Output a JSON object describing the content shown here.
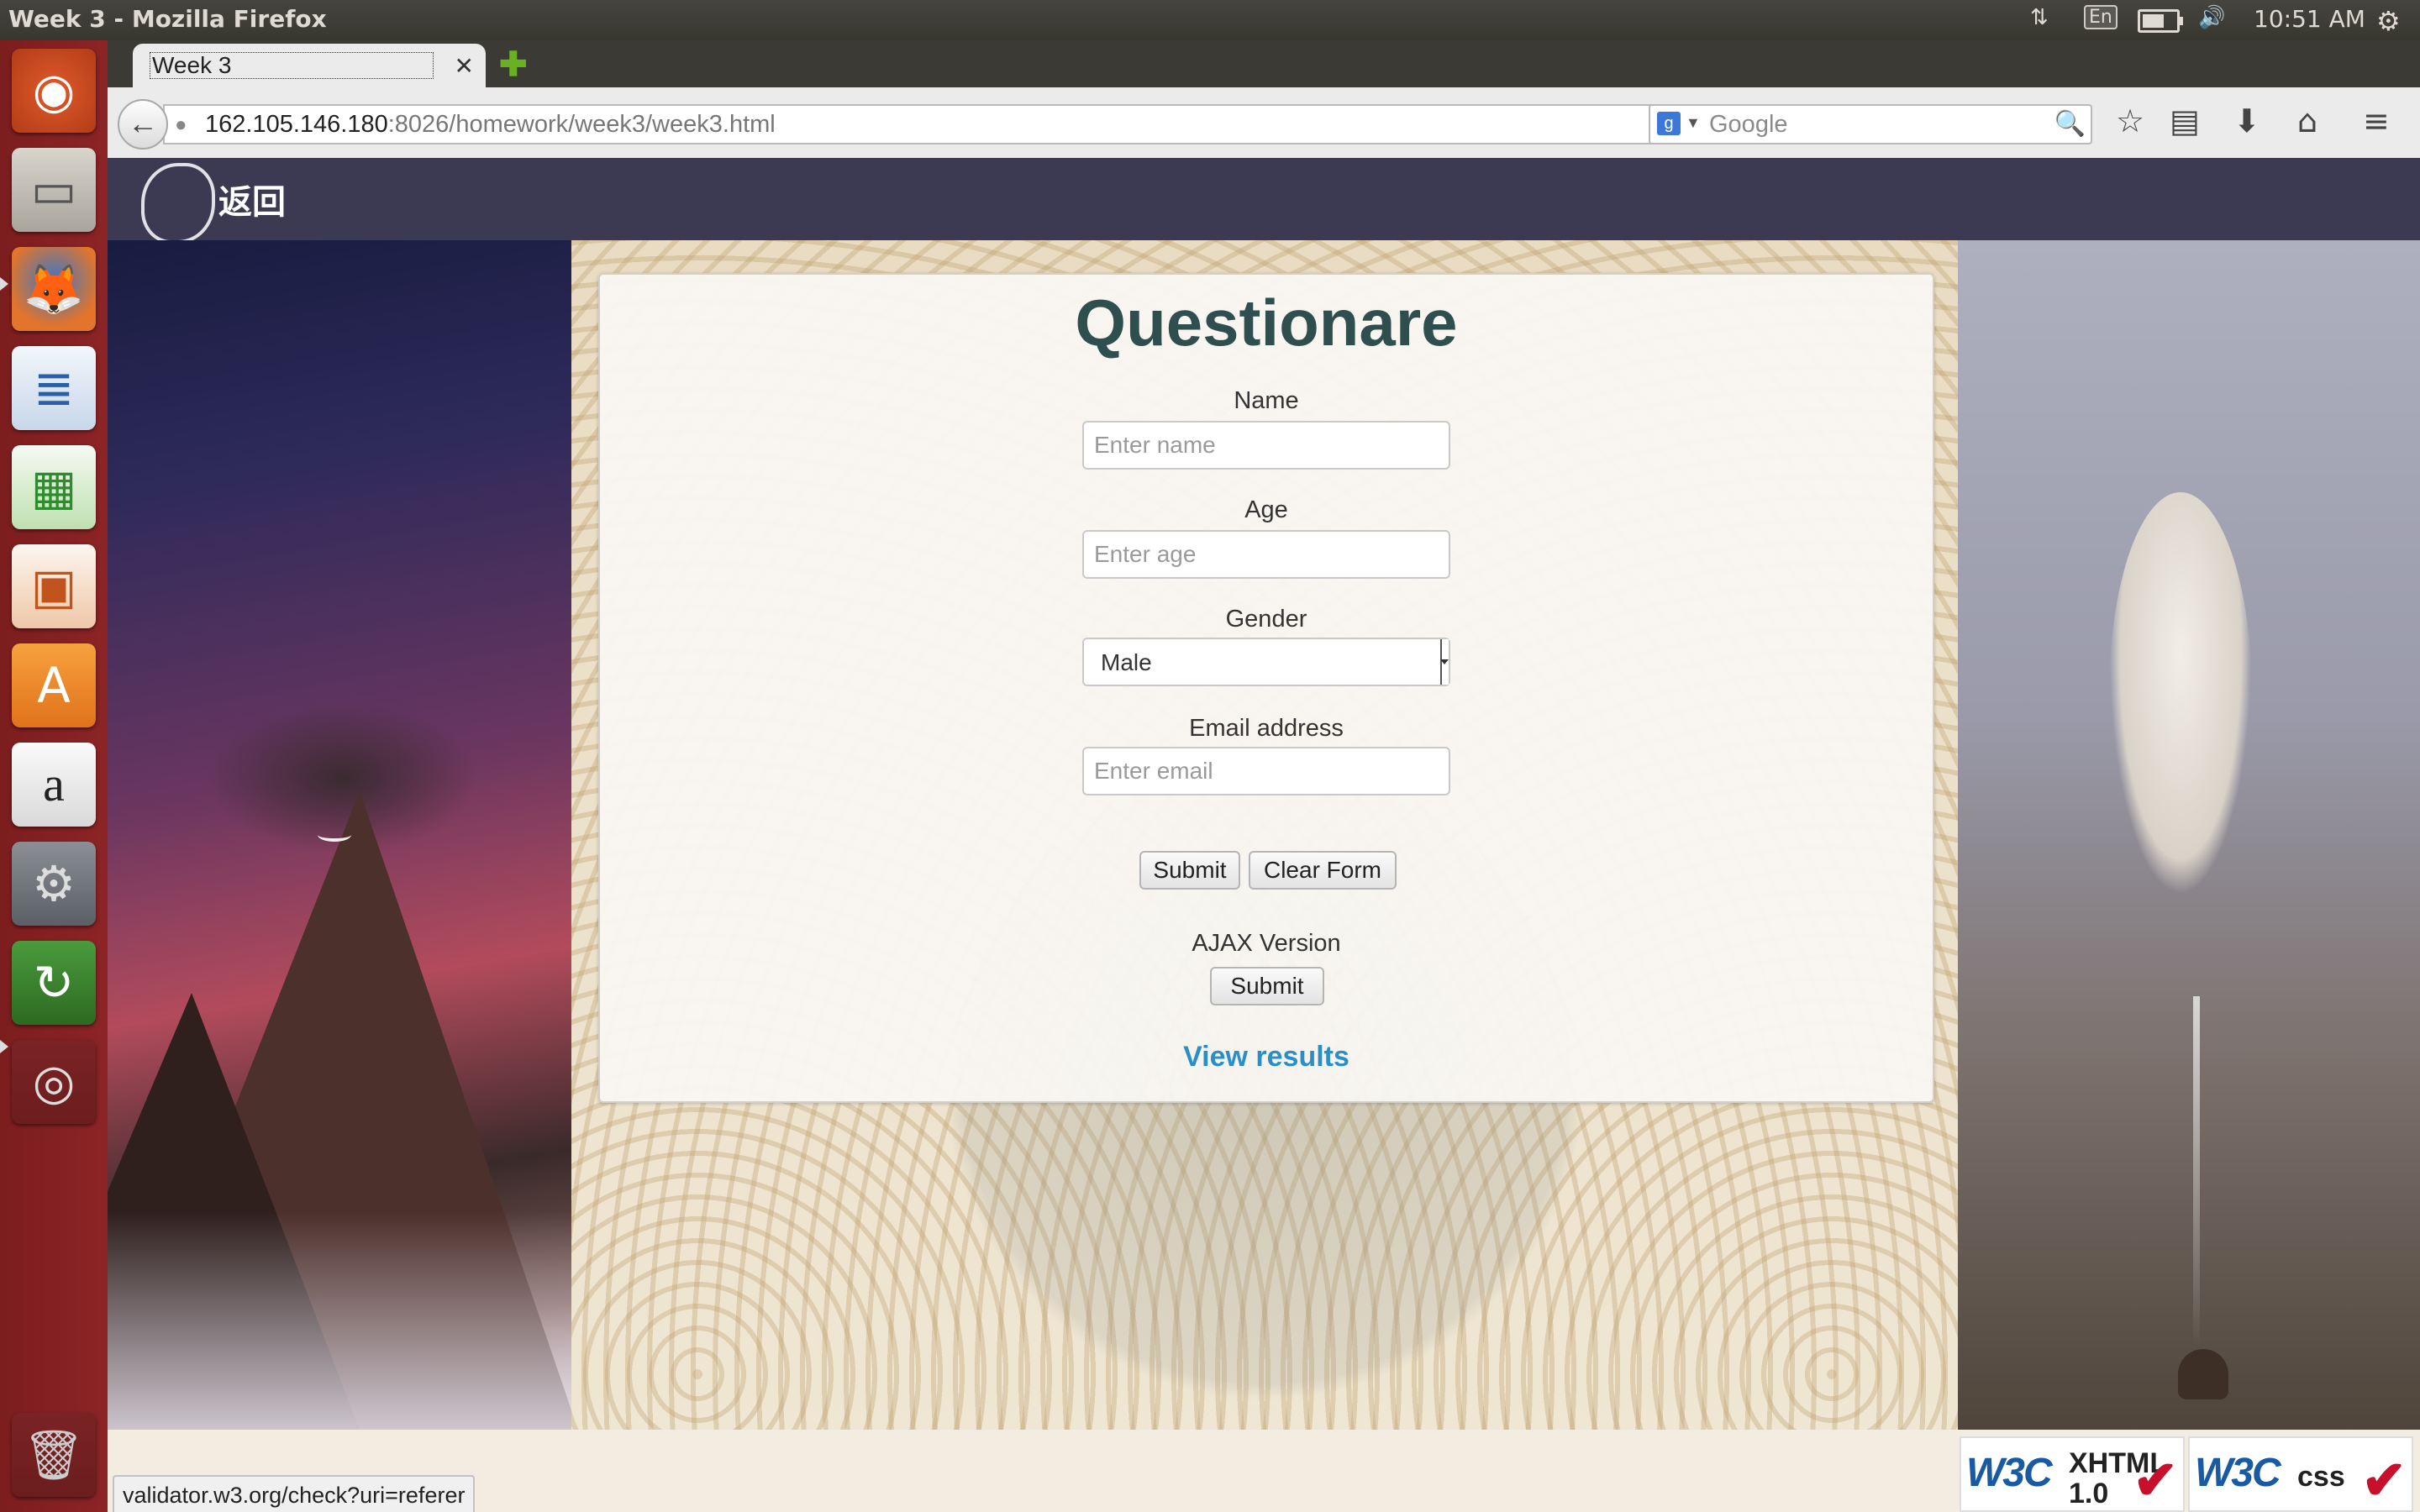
{
  "panel": {
    "window_title": "Week 3 - Mozilla Firefox",
    "language": "En",
    "battery_level": 0.7,
    "clock": "10:51 AM"
  },
  "launcher": {
    "apps": [
      "ubuntu-dash",
      "files",
      "firefox",
      "libreoffice-writer",
      "libreoffice-calc",
      "libreoffice-impress",
      "ubuntu-software-center",
      "amazon",
      "system-settings",
      "software-updater",
      "dvd",
      "trash"
    ]
  },
  "browser": {
    "tab_title": "Week 3",
    "url_host": "162.105.146.180",
    "url_path": ":8026/homework/week3/week3.html",
    "search_placeholder": "Google",
    "status_text": "validator.w3.org/check?uri=referer"
  },
  "site": {
    "logo_text": "返回"
  },
  "form": {
    "title": "Questionare",
    "name_label": "Name",
    "name_placeholder": "Enter name",
    "age_label": "Age",
    "age_placeholder": "Enter age",
    "gender_label": "Gender",
    "gender_selected": "Male",
    "email_label": "Email address",
    "email_placeholder": "Enter email",
    "submit_label": "Submit",
    "clear_label": "Clear Form",
    "ajax_label": "AJAX Version",
    "ajax_submit_label": "Submit",
    "view_results": "View results"
  },
  "badges": {
    "xhtml_w3c": "W3C",
    "xhtml_kind_1": "XHTML",
    "xhtml_kind_2": "1.0",
    "css_w3c": "W3C",
    "css_kind": "css"
  },
  "colors": {
    "title": "#2f4f4f",
    "link": "#2a8fc7",
    "header_bar": "#3b3a52",
    "launcher": "#8c2426"
  }
}
